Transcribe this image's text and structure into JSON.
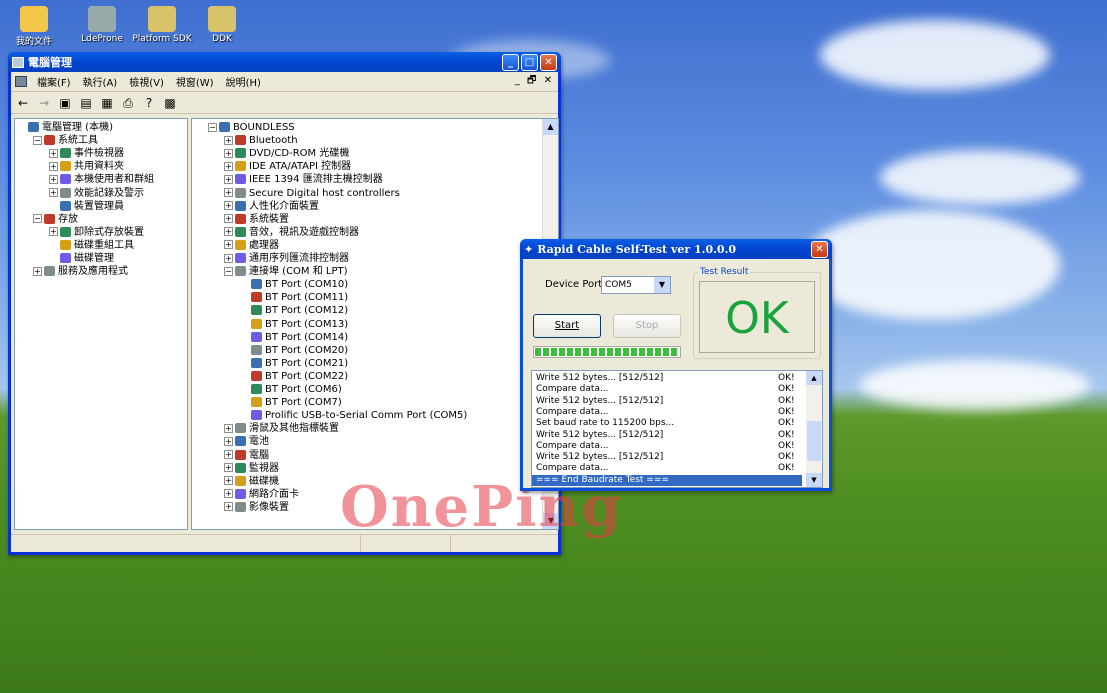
{
  "desktop": {
    "icons": [
      {
        "label": "我的文件",
        "icon": "folder-icon"
      },
      {
        "label": "LdeProne",
        "icon": "shortcut-icon"
      },
      {
        "label": "Platform SDK",
        "icon": "help-icon"
      },
      {
        "label": "DDK",
        "icon": "help-icon"
      }
    ],
    "watermark": "OnePing"
  },
  "computer_management": {
    "title": "電腦管理",
    "menu": [
      "檔案(F)",
      "執行(A)",
      "檢視(V)",
      "視窗(W)",
      "說明(H)"
    ],
    "tree_left": [
      {
        "text": "電腦管理 (本機)",
        "level": 0,
        "expander": ""
      },
      {
        "text": "系統工具",
        "level": 1,
        "expander": "−"
      },
      {
        "text": "事件檢視器",
        "level": 2,
        "expander": "+"
      },
      {
        "text": "共用資料夾",
        "level": 2,
        "expander": "+"
      },
      {
        "text": "本機使用者和群組",
        "level": 2,
        "expander": "+"
      },
      {
        "text": "效能記錄及警示",
        "level": 2,
        "expander": "+"
      },
      {
        "text": "裝置管理員",
        "level": 2,
        "expander": ""
      },
      {
        "text": "存放",
        "level": 1,
        "expander": "−"
      },
      {
        "text": "卸除式存放裝置",
        "level": 2,
        "expander": "+"
      },
      {
        "text": "磁碟重組工具",
        "level": 2,
        "expander": ""
      },
      {
        "text": "磁碟管理",
        "level": 2,
        "expander": ""
      },
      {
        "text": "服務及應用程式",
        "level": 1,
        "expander": "+"
      }
    ],
    "tree_right": [
      {
        "text": "BOUNDLESS",
        "level": 0,
        "expander": "−"
      },
      {
        "text": "Bluetooth",
        "level": 1,
        "expander": "+"
      },
      {
        "text": "DVD/CD-ROM 光碟機",
        "level": 1,
        "expander": "+"
      },
      {
        "text": "IDE ATA/ATAPI 控制器",
        "level": 1,
        "expander": "+"
      },
      {
        "text": "IEEE 1394 匯流排主機控制器",
        "level": 1,
        "expander": "+"
      },
      {
        "text": "Secure Digital host controllers",
        "level": 1,
        "expander": "+"
      },
      {
        "text": "人性化介面裝置",
        "level": 1,
        "expander": "+"
      },
      {
        "text": "系統裝置",
        "level": 1,
        "expander": "+"
      },
      {
        "text": "音效，視訊及遊戲控制器",
        "level": 1,
        "expander": "+"
      },
      {
        "text": "處理器",
        "level": 1,
        "expander": "+"
      },
      {
        "text": "通用序列匯流排控制器",
        "level": 1,
        "expander": "+"
      },
      {
        "text": "連接埠 (COM 和 LPT)",
        "level": 1,
        "expander": "−"
      },
      {
        "text": "BT Port (COM10)",
        "level": 2,
        "expander": ""
      },
      {
        "text": "BT Port (COM11)",
        "level": 2,
        "expander": ""
      },
      {
        "text": "BT Port (COM12)",
        "level": 2,
        "expander": ""
      },
      {
        "text": "BT Port (COM13)",
        "level": 2,
        "expander": ""
      },
      {
        "text": "BT Port (COM14)",
        "level": 2,
        "expander": ""
      },
      {
        "text": "BT Port (COM20)",
        "level": 2,
        "expander": ""
      },
      {
        "text": "BT Port (COM21)",
        "level": 2,
        "expander": ""
      },
      {
        "text": "BT Port (COM22)",
        "level": 2,
        "expander": ""
      },
      {
        "text": "BT Port (COM6)",
        "level": 2,
        "expander": ""
      },
      {
        "text": "BT Port (COM7)",
        "level": 2,
        "expander": ""
      },
      {
        "text": "Prolific USB-to-Serial Comm Port (COM5)",
        "level": 2,
        "expander": ""
      },
      {
        "text": "滑鼠及其他指標裝置",
        "level": 1,
        "expander": "+"
      },
      {
        "text": "電池",
        "level": 1,
        "expander": "+"
      },
      {
        "text": "電腦",
        "level": 1,
        "expander": "+"
      },
      {
        "text": "監視器",
        "level": 1,
        "expander": "+"
      },
      {
        "text": "磁碟機",
        "level": 1,
        "expander": "+"
      },
      {
        "text": "網路介面卡",
        "level": 1,
        "expander": "+"
      },
      {
        "text": "影像裝置",
        "level": 1,
        "expander": "+"
      }
    ]
  },
  "self_test": {
    "title": "Rapid Cable Self-Test  ver 1.0.0.0",
    "device_port_label": "Device Port",
    "device_port_value": "COM5",
    "test_result_label": "Test Result",
    "result": "OK",
    "start_label": "Start",
    "stop_label": "Stop",
    "progress": 1.0,
    "log": [
      {
        "msg": "Write 512 bytes... [512/512]",
        "status": "OK!"
      },
      {
        "msg": "Compare data...",
        "status": "OK!"
      },
      {
        "msg": "Write 512 bytes... [512/512]",
        "status": "OK!"
      },
      {
        "msg": "Compare data...",
        "status": "OK!"
      },
      {
        "msg": "Set baud rate to 115200 bps...",
        "status": "OK!"
      },
      {
        "msg": "Write 512 bytes... [512/512]",
        "status": "OK!"
      },
      {
        "msg": "Compare data...",
        "status": "OK!"
      },
      {
        "msg": "Write 512 bytes... [512/512]",
        "status": "OK!"
      },
      {
        "msg": "Compare data...",
        "status": "OK!"
      },
      {
        "msg": "=== End Baudrate Test ===",
        "status": ""
      }
    ]
  }
}
